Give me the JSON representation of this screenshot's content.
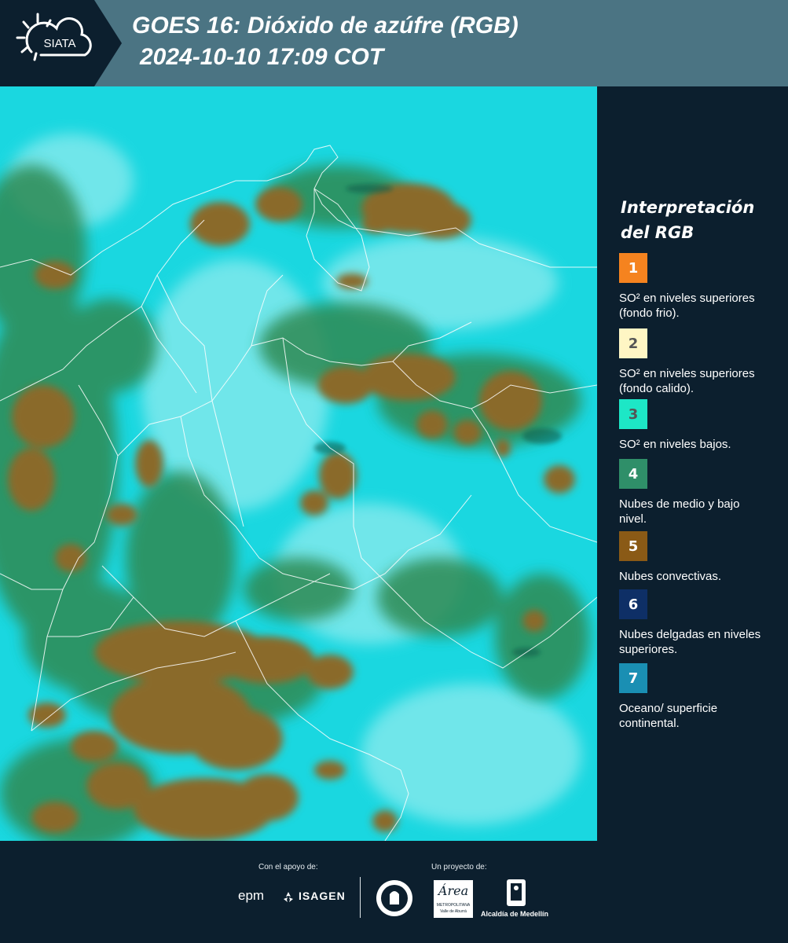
{
  "header": {
    "logo_text": "SIATA",
    "title_line1": "GOES 16: Dióxido de azúfre (RGB)",
    "title_line2": "2024-10-10 17:09 COT"
  },
  "legend": {
    "title": "Interpretación del RGB",
    "items": [
      {
        "number": "1",
        "label": "SO² en niveles superiores (fondo frio).",
        "color": "#f5831f",
        "text_color": "#ffffff"
      },
      {
        "number": "2",
        "label": "SO² en niveles superiores (fondo calido).",
        "color": "#fff6c4",
        "text_color": "#555555"
      },
      {
        "number": "3",
        "label": "SO² en niveles bajos.",
        "color": "#1de7c6",
        "text_color": "#555555"
      },
      {
        "number": "4",
        "label": "Nubes de medio y bajo nivel.",
        "color": "#2f8f69",
        "text_color": "#ffffff"
      },
      {
        "number": "5",
        "label": "Nubes convectivas.",
        "color": "#8a5a16",
        "text_color": "#ffffff"
      },
      {
        "number": "6",
        "label": "Nubes delgadas en niveles superiores.",
        "color": "#0e2f66",
        "text_color": "#ffffff"
      },
      {
        "number": "7",
        "label": "Oceano/ superficie continental.",
        "color": "#1a8fb3",
        "text_color": "#ffffff"
      }
    ]
  },
  "footer": {
    "support_label": "Con el apoyo de:",
    "project_label": "Un proyecto de:",
    "sponsor_epm": "epm",
    "sponsor_isagen": "ISAGEN",
    "area_name": "Área",
    "area_sub": "METROPOLITANA",
    "area_sub2": "Valle de Aburrá",
    "alcaldia": "Alcaldía de Medellín"
  },
  "colors": {
    "header_bg": "#4b7483",
    "panel_bg": "#0c1f2e",
    "ocean": "#19d8e2",
    "convective": "#8a6a2a",
    "midlevel": "#2e8a52"
  }
}
